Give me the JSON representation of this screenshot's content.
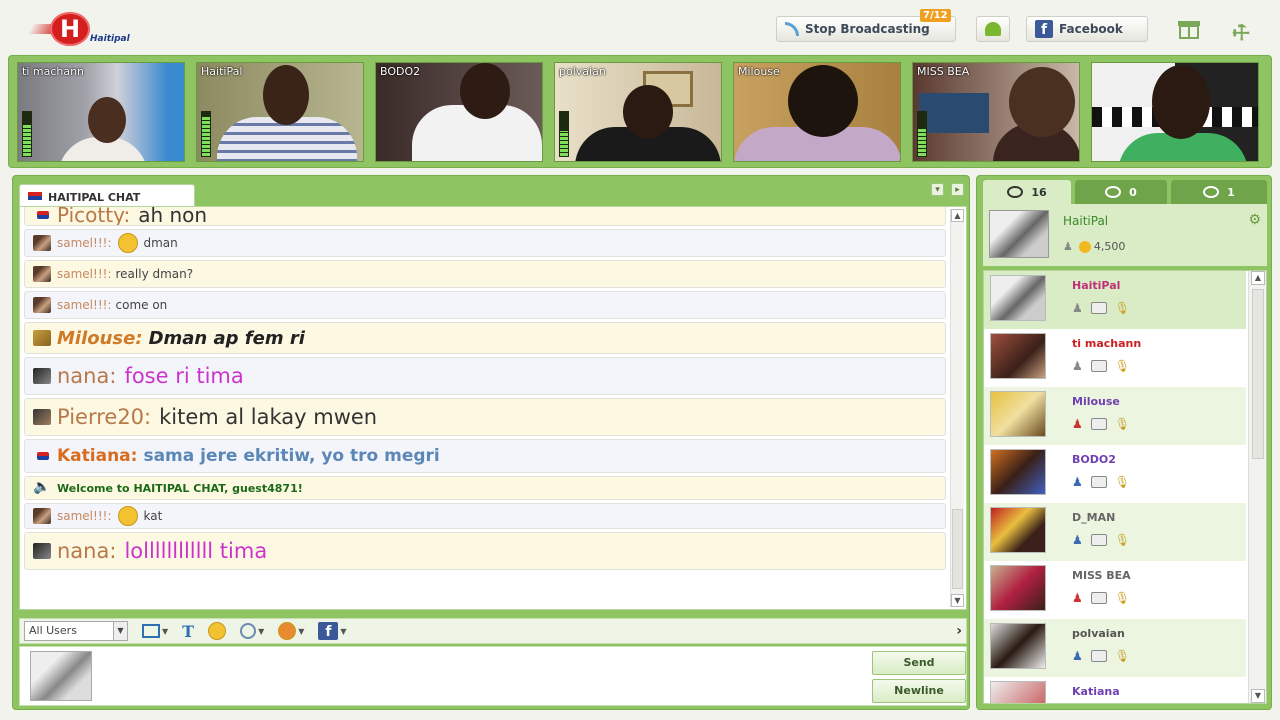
{
  "header": {
    "brand": "Haitipal",
    "broadcast_label": "Stop Broadcasting",
    "broadcast_badge": "7/12",
    "facebook_label": "Facebook"
  },
  "cams": [
    {
      "name": "ti machann"
    },
    {
      "name": "HaitiPal"
    },
    {
      "name": "BODO2"
    },
    {
      "name": "polvaian"
    },
    {
      "name": "Milouse"
    },
    {
      "name": "MISS BEA"
    },
    {
      "name": ""
    }
  ],
  "chat": {
    "tab_title": "HAITIPAL CHAT",
    "messages": [
      {
        "sender": "Picotty:",
        "text": "ah non"
      },
      {
        "sender": "samel!!!:",
        "text": "dman"
      },
      {
        "sender": "samel!!!:",
        "text": "really dman?"
      },
      {
        "sender": "samel!!!:",
        "text": "come on"
      },
      {
        "sender": "Milouse:",
        "text": "Dman ap fem ri"
      },
      {
        "sender": "nana:",
        "text": "fose ri tima"
      },
      {
        "sender": "Pierre20:",
        "text": "kitem al lakay mwen"
      },
      {
        "sender": "Katiana:",
        "text": "sama jere ekritiw, yo  tro megri"
      },
      {
        "sender": "",
        "text": "Welcome to HAITIPAL CHAT, guest4871!"
      },
      {
        "sender": "samel!!!:",
        "text": "kat"
      },
      {
        "sender": "nana:",
        "text": "lollllllllllll tima"
      }
    ],
    "user_filter": "All Users",
    "send_label": "Send",
    "newline_label": "Newline"
  },
  "userpanel": {
    "tabs": [
      {
        "count": "16"
      },
      {
        "count": "0"
      },
      {
        "count": "1"
      }
    ],
    "me": {
      "name": "HaitiPal",
      "credits": "4,500"
    },
    "users": [
      {
        "name": "HaitiPal",
        "color": "#c0307a"
      },
      {
        "name": "ti machann",
        "color": "#cc2020"
      },
      {
        "name": "Milouse",
        "color": "#7040b0"
      },
      {
        "name": "BODO2",
        "color": "#7040b0"
      },
      {
        "name": "D_MAN",
        "color": "#666666"
      },
      {
        "name": "MISS BEA",
        "color": "#666666"
      },
      {
        "name": "polvaian",
        "color": "#555555"
      },
      {
        "name": "Katiana",
        "color": "#7040b0"
      }
    ]
  },
  "colors": {
    "panel_green": "#8fc462",
    "tab_active": "#d9ecc5",
    "nana_text": "#cc33cc",
    "katiana_text": "#5b87b8"
  }
}
